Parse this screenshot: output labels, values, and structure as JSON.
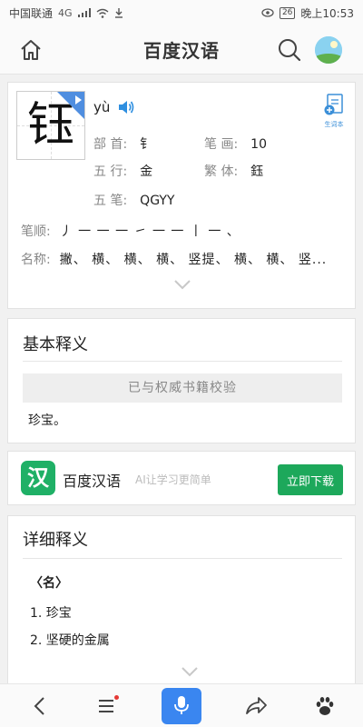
{
  "status_bar": {
    "carrier": "中国联通",
    "network": "4G",
    "battery": "26",
    "time": "晚上10:53"
  },
  "header": {
    "title": "百度汉语"
  },
  "character": {
    "glyph": "钰",
    "pinyin": "yù",
    "wordbook_label": "生词本",
    "radical_label": "部 首:",
    "radical_value": "钅",
    "strokes_label": "笔 画:",
    "strokes_value": "10",
    "wuxing_label": "五 行:",
    "wuxing_value": "金",
    "traditional_label": "繁 体:",
    "traditional_value": "鈺",
    "wubi_label": "五 笔:",
    "wubi_value": "QGYY",
    "stroke_order_label": "笔顺:",
    "stroke_order_value": "丿 一 一 一 ㇀ 一 一 丨 一 、",
    "stroke_names_label": "名称:",
    "stroke_names_value": "撇、 横、 横、 横、 竖提、 横、 横、 竖..."
  },
  "basic_meaning": {
    "title": "基本释义",
    "verified": "已与权威书籍校验",
    "definition": "珍宝。"
  },
  "promo": {
    "icon_text": "汉",
    "app_name": "百度汉语",
    "slogan": "AI让学习更简单",
    "download_label": "立即下载"
  },
  "detailed_meaning": {
    "title": "详细释义",
    "part_of_speech": "〈名〉",
    "items": [
      "1. 珍宝",
      "2. 坚硬的金属"
    ]
  },
  "colors": {
    "accent_blue": "#3a86f0",
    "download_green": "#1da85b",
    "app_icon_green": "#1fb066"
  },
  "icons": [
    "home-icon",
    "search-icon",
    "avatar",
    "speaker-icon",
    "wordbook-icon",
    "chevron-down-icon",
    "back-icon",
    "menu-icon",
    "microphone-icon",
    "share-icon",
    "paw-icon"
  ]
}
